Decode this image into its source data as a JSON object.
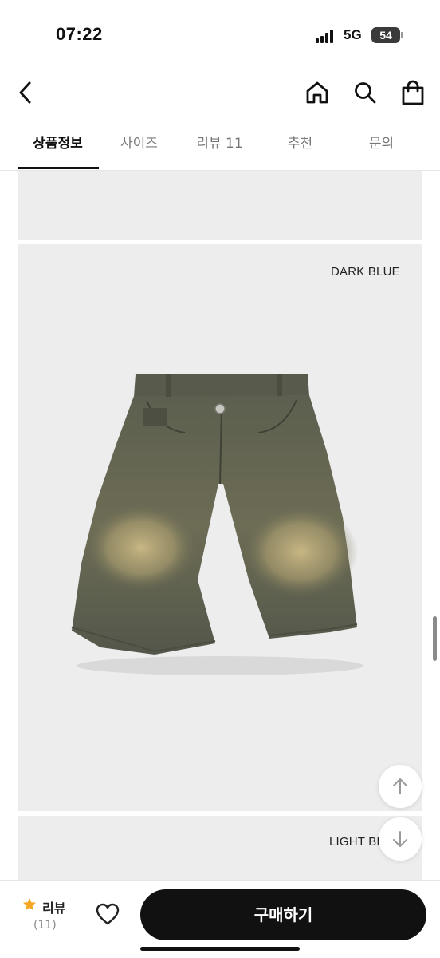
{
  "status_bar": {
    "time": "07:22",
    "network": "5G",
    "battery": "54"
  },
  "header": {
    "back_icon": "chevron-left-icon",
    "home_icon": "home-icon",
    "search_icon": "search-icon",
    "bag_icon": "shopping-bag-icon"
  },
  "tabs": [
    {
      "label": "상품정보",
      "active": true
    },
    {
      "label": "사이즈",
      "active": false
    },
    {
      "label": "리뷰 11",
      "active": false
    },
    {
      "label": "추천",
      "active": false
    },
    {
      "label": "문의",
      "active": false
    }
  ],
  "content": {
    "dark_blue_label": "DARK BLUE",
    "light_blue_label": "LIGHT BLUE",
    "product_image": "denim-shorts-image"
  },
  "float_buttons": {
    "up_icon": "arrow-up-icon",
    "down_icon": "arrow-down-icon"
  },
  "bottom_bar": {
    "review_label": "리뷰",
    "review_count": "(11)",
    "star_color": "#f5a623",
    "buy_label": "구매하기"
  }
}
